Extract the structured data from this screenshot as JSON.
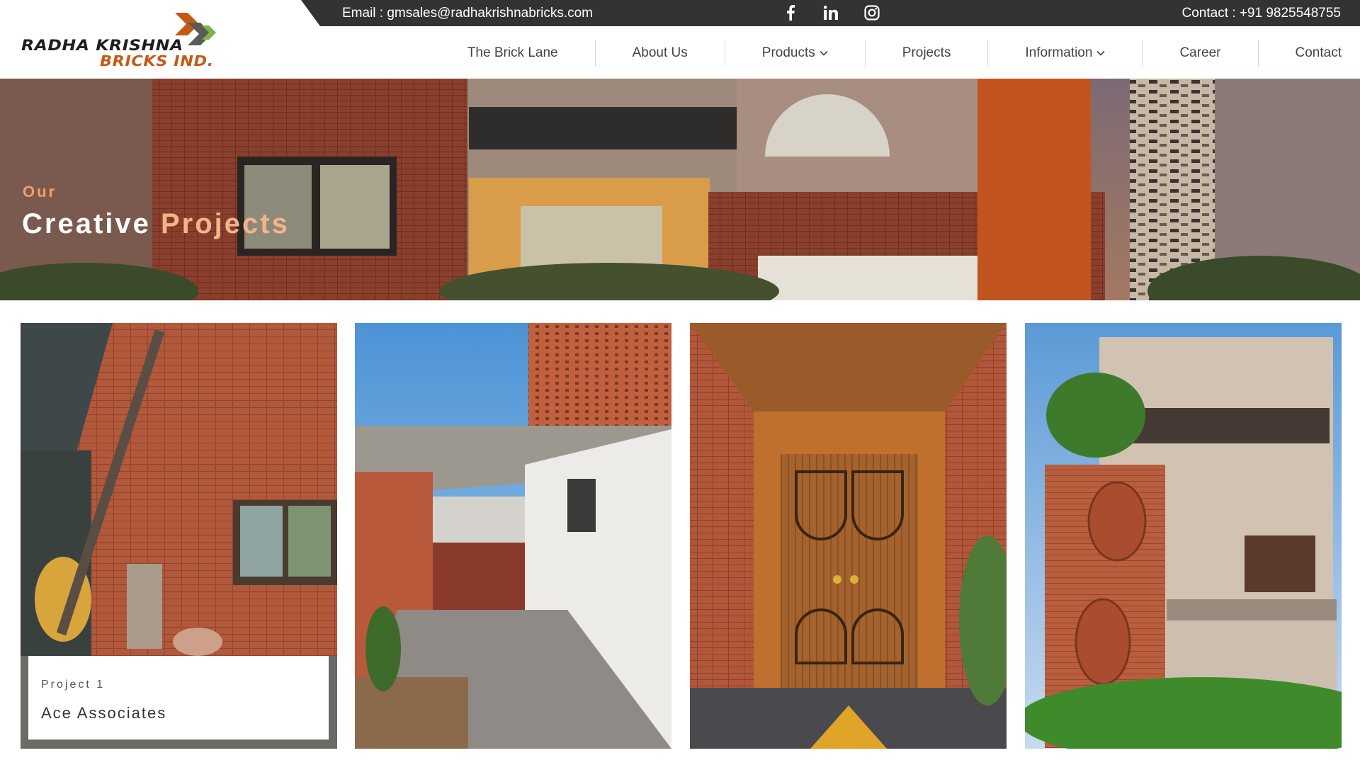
{
  "topbar": {
    "email": "Email : gmsales@radhakrishnabricks.com",
    "contact": "Contact : +91 9825548755",
    "social": [
      "facebook-icon",
      "linkedin-icon",
      "instagram-icon"
    ]
  },
  "logo": {
    "line1": "RADHA KRISHNA",
    "line2": "BRICKS IND."
  },
  "nav": {
    "items": [
      {
        "label": "The Brick Lane",
        "dropdown": false
      },
      {
        "label": "About Us",
        "dropdown": false
      },
      {
        "label": "Products",
        "dropdown": true
      },
      {
        "label": "Projects",
        "dropdown": false
      },
      {
        "label": "Information",
        "dropdown": true
      },
      {
        "label": "Career",
        "dropdown": false
      },
      {
        "label": "Contact",
        "dropdown": false
      }
    ]
  },
  "hero": {
    "eyebrow": "Our",
    "title_white": "Creative",
    "title_accent": "Projects"
  },
  "projects": [
    {
      "number": "Project 1",
      "name": "Ace Associates"
    }
  ],
  "colors": {
    "topbar": "#333333",
    "brand_orange": "#c45a16",
    "accent_peach": "#f3b48a",
    "brick": "#b2583b"
  }
}
